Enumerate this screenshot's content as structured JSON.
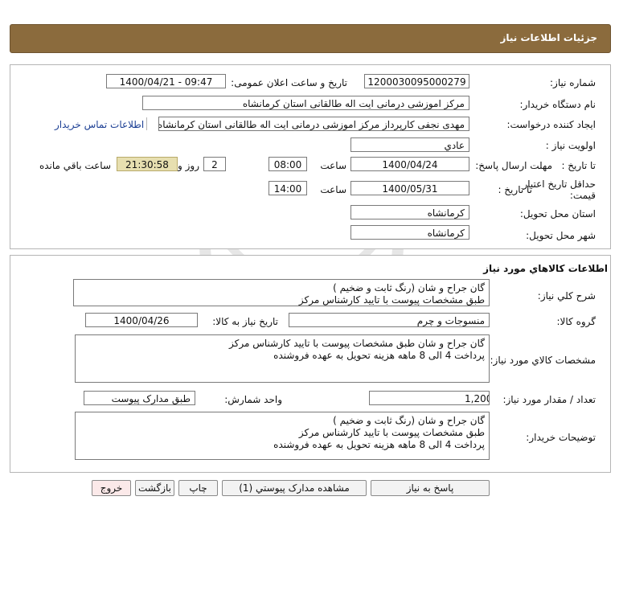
{
  "header": {
    "title": "جزئیات اطلاعات نیاز"
  },
  "info": {
    "need_number_label": "شماره نیاز:",
    "need_number": "1200030095000279",
    "announce_label": "تاریخ و ساعت اعلان عمومی:",
    "announce_value": "1400/04/21 - 09:47",
    "buyer_org_label": "نام دستگاه خریدار:",
    "buyer_org": "مرکز اموزشی درمانی ایت اله طالقانی استان کرمانشاه",
    "creator_label": "ایجاد کننده درخواست:",
    "creator": "مهدی نجفی کارپرداز مرکز اموزشی درمانی ایت اله طالقانی استان کرمانشاه",
    "contact_link": "اطلاعات تماس خریدار",
    "priority_label": "اولویت نیاز :",
    "priority": "عادي",
    "reply_deadline_label": "مهلت ارسال پاسخ:",
    "to_date_label": "تا تاریخ :",
    "reply_date": "1400/04/24",
    "time_label": "ساعت",
    "reply_time": "08:00",
    "days_value": "2",
    "days_label": "روز و",
    "remaining": "21:30:58",
    "remaining_label": "ساعت باقي مانده",
    "price_validity_label_1": "حداقل تاریخ اعتبار",
    "price_validity_label_2": "قیمت:",
    "price_to_date_label": "تا تاریخ :",
    "price_date": "1400/05/31",
    "price_time_label": "ساعت",
    "price_time": "14:00",
    "province_label": "استان محل تحویل:",
    "province": "کرمانشاه",
    "city_label": "شهر محل تحویل:",
    "city": "کرمانشاه"
  },
  "goods": {
    "section_title": "اطلاعات کالاهاي مورد نياز",
    "summary_label": "شرح کلي نياز:",
    "summary_lines": [
      "گان جراح و شان (رنگ ثابت و ضخیم )",
      "طبق مشخصات پیوست با تایید کارشناس مرکز"
    ],
    "group_label": "گروه کالا:",
    "group": "منسوجات و چرم",
    "need_date_label": "تاریخ نیاز به کالا:",
    "need_date": "1400/04/26",
    "specs_label": "مشخصات کالاي مورد نياز:",
    "specs_lines": [
      "گان جراح و شان طبق مشخصات پیوست با تایید کارشناس مرکز",
      "پرداخت 4 الی 8 ماهه هزینه تحویل به عهده فروشنده"
    ],
    "qty_label": "تعداد / مقدار مورد نیاز:",
    "qty": "1,200",
    "unit_label": "واحد شمارش:",
    "unit": "طبق مدارک پیوست",
    "buyer_notes_label": "توضیحات خریدار:",
    "buyer_notes_lines": [
      "گان جراح و شان (رنگ ثابت و ضخیم )",
      "طبق مشخصات پیوست با تایید کارشناس مرکز",
      "پرداخت 4 الی 8 ماهه هزینه تحویل به عهده فروشنده"
    ]
  },
  "buttons": {
    "reply": "پاسخ به نیاز",
    "view_attachments": "مشاهده مدارک پیوستي (1)",
    "print": "چاپ",
    "back": "بازگشت",
    "exit": "خروج"
  },
  "colors": {
    "header_bg": "#8b6b3d",
    "remaining_bg": "#e7dfb0",
    "link": "#1c3f94"
  }
}
